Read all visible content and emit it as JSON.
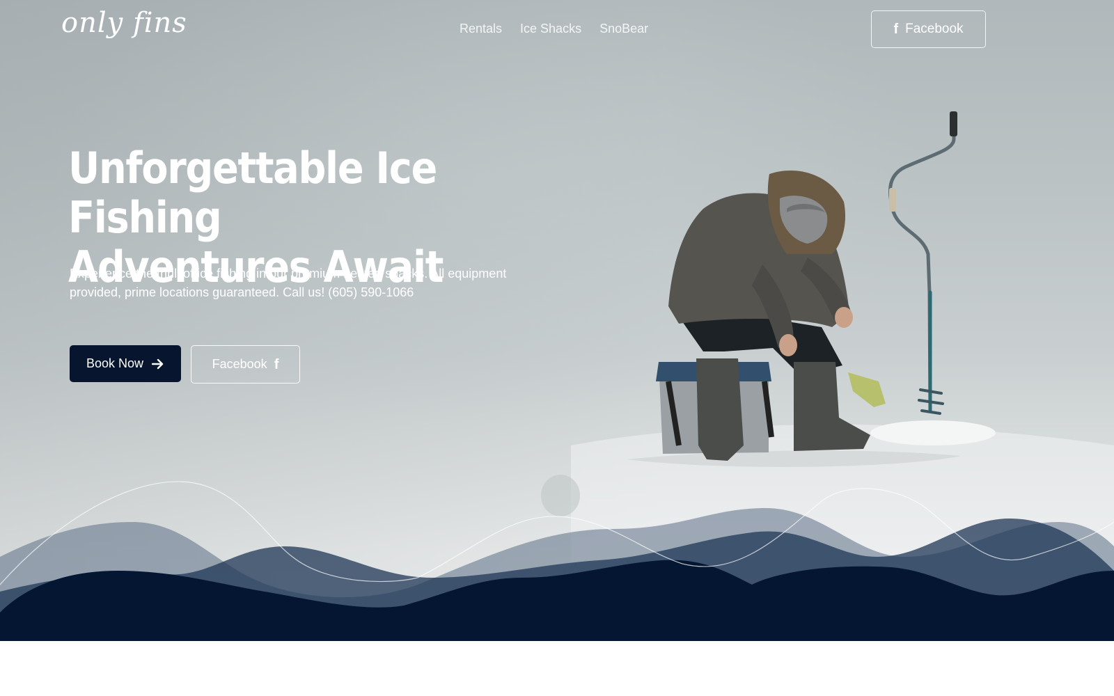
{
  "header": {
    "logo": "only fins",
    "nav": [
      {
        "label": "Rentals"
      },
      {
        "label": "Ice Shacks"
      },
      {
        "label": "SnoBear"
      }
    ],
    "facebook_label": "Facebook",
    "facebook_icon": "facebook-icon"
  },
  "hero": {
    "title_line1": "Unforgettable Ice Fishing",
    "title_line2": "Adventures Await",
    "subtitle": "Experience the thrill of ice fishing in our premium heated shacks. All equipment provided, prime locations guaranteed. Call us! (605) 590-1066",
    "book_label": "Book Now",
    "book_icon": "arrow-right-icon",
    "facebook_label": "Facebook",
    "facebook_icon": "facebook-icon"
  },
  "colors": {
    "navy": "#07152f",
    "wave_mid": "#1f3756",
    "wave_light": "#5c6f86"
  }
}
